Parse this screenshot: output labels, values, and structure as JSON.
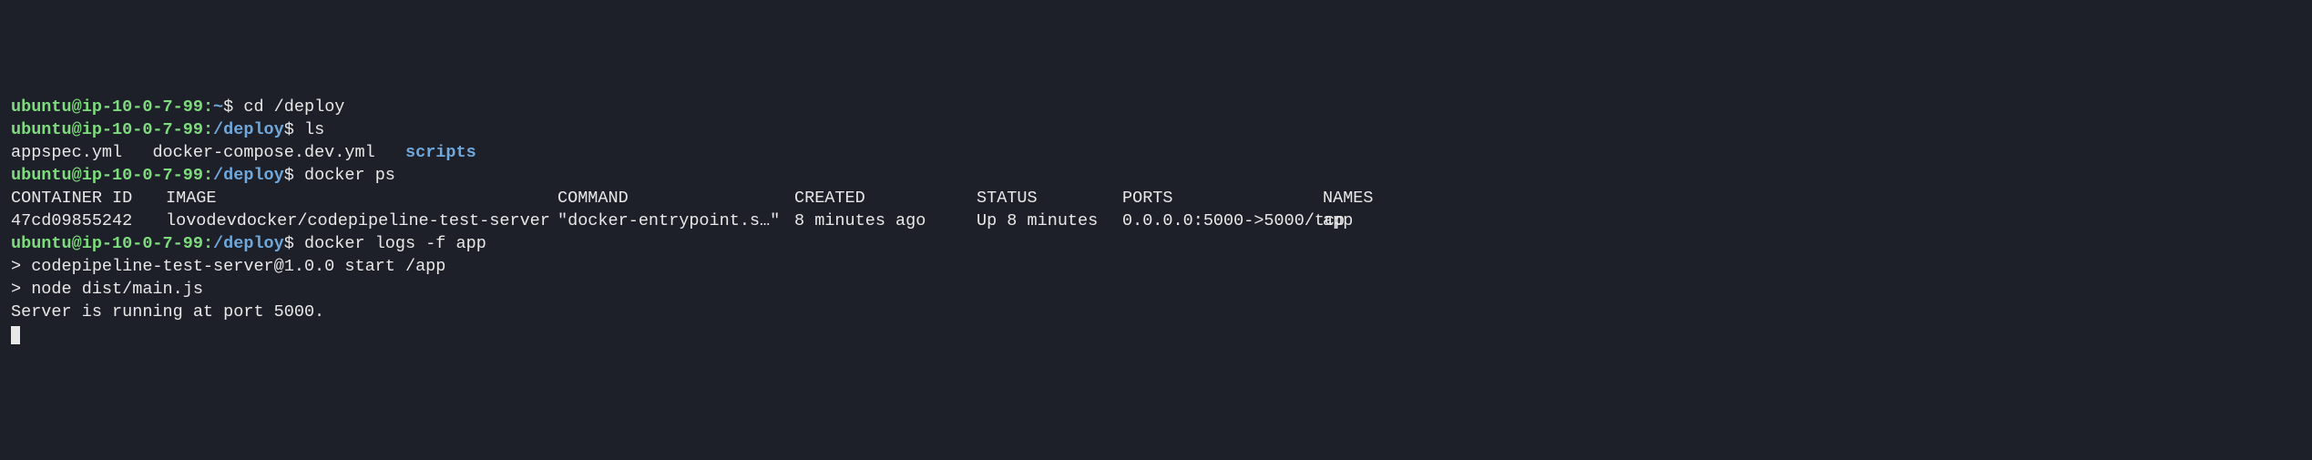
{
  "prompts": [
    {
      "user": "ubuntu@ip-10-0-7-99",
      "path": "~",
      "command": "cd /deploy"
    },
    {
      "user": "ubuntu@ip-10-0-7-99",
      "path": "/deploy",
      "command": "ls"
    },
    {
      "user": "ubuntu@ip-10-0-7-99",
      "path": "/deploy",
      "command": "docker ps"
    },
    {
      "user": "ubuntu@ip-10-0-7-99",
      "path": "/deploy",
      "command": "docker logs -f app"
    }
  ],
  "ls_output": {
    "files": [
      "appspec.yml",
      "docker-compose.dev.yml"
    ],
    "dirs": [
      "scripts"
    ]
  },
  "docker_ps": {
    "headers": {
      "id": "CONTAINER ID",
      "image": "IMAGE",
      "command": "COMMAND",
      "created": "CREATED",
      "status": "STATUS",
      "ports": "PORTS",
      "names": "NAMES"
    },
    "rows": [
      {
        "id": "47cd09855242",
        "image": "lovodevdocker/codepipeline-test-server",
        "command": "\"docker-entrypoint.s…\"",
        "created": "8 minutes ago",
        "status": "Up 8 minutes",
        "ports": "0.0.0.0:5000->5000/tcp",
        "names": "app"
      }
    ]
  },
  "logs": [
    "",
    "> codepipeline-test-server@1.0.0 start /app",
    "> node dist/main.js",
    "",
    "Server is running at port 5000."
  ]
}
